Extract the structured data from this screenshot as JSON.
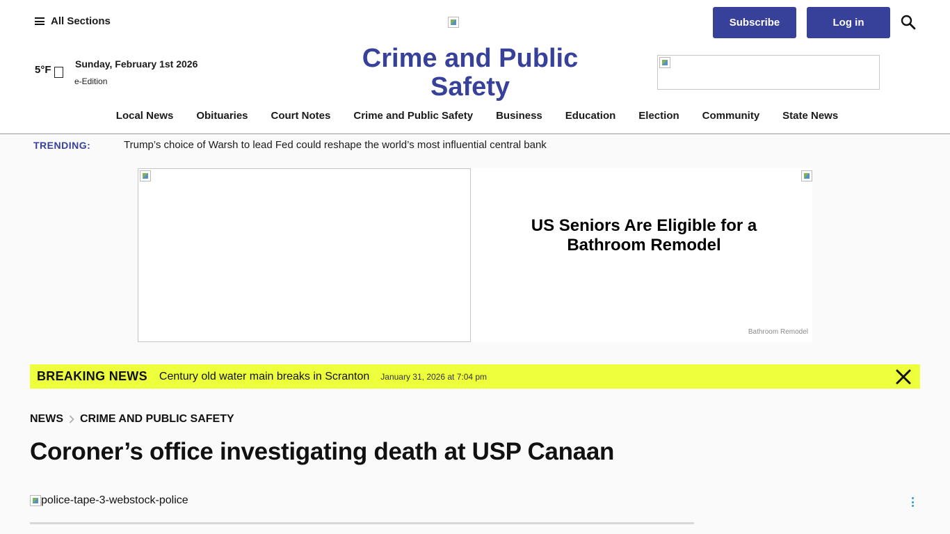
{
  "header": {
    "all_sections_label": "All Sections",
    "subscribe_label": "Subscribe",
    "login_label": "Log in",
    "weather_temp": "5°F",
    "date": "Sunday, February 1st 2026",
    "eedition_label": "e-Edition",
    "section_title": "Crime and Public Safety",
    "brand_color": "#37419a"
  },
  "nav": {
    "items": [
      {
        "label": "Local News"
      },
      {
        "label": "Obituaries"
      },
      {
        "label": "Court Notes"
      },
      {
        "label": "Crime and Public Safety"
      },
      {
        "label": "Business"
      },
      {
        "label": "Education"
      },
      {
        "label": "Election"
      },
      {
        "label": "Community"
      },
      {
        "label": "State News"
      }
    ]
  },
  "trending": {
    "label": "TRENDING:",
    "text": "Trump’s choice of Warsh to lead Fed could reshape the world’s most influential central bank"
  },
  "ad": {
    "headline": "US Seniors Are Eligible for a Bathroom Remodel",
    "sponsor": "Bathroom Remodel"
  },
  "breaking": {
    "label": "BREAKING NEWS",
    "text": "Century old water main breaks in Scranton",
    "time": "January 31, 2026 at 7:04 pm",
    "bg_color": "#eeff3b"
  },
  "article": {
    "breadcrumb": [
      "NEWS",
      "CRIME AND PUBLIC SAFETY"
    ],
    "title": "Coroner’s office investigating death at USP Canaan",
    "photo_alt": "police-tape-3-webstock-police"
  },
  "icons": {
    "menu": "hamburger-icon",
    "search": "search-icon",
    "close": "close-icon",
    "more": "kebab-icon"
  }
}
